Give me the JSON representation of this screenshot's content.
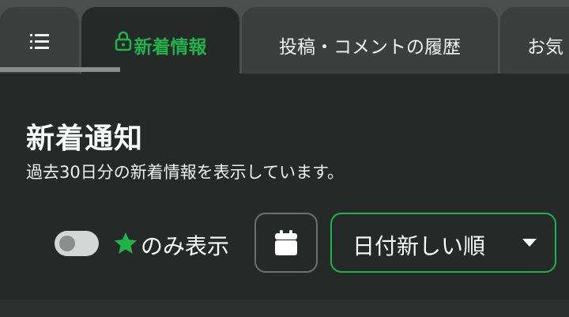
{
  "tabs": {
    "menu": {
      "icon": "menu-list-icon"
    },
    "news": {
      "label": "新着情報",
      "icon": "lock-icon",
      "active": true
    },
    "posts": {
      "label": "投稿・コメントの履歴"
    },
    "favorites": {
      "label": "お気"
    }
  },
  "main": {
    "title": "新着通知",
    "subtitle": "過去30日分の新着情報を表示しています。"
  },
  "filters": {
    "star_only": {
      "enabled": false,
      "icon": "star-icon",
      "label": "のみ表示"
    },
    "calendar": {
      "icon": "calendar-icon"
    },
    "sort": {
      "selected": "日付新しい順",
      "icon": "chevron-down-icon"
    }
  },
  "colors": {
    "accent": "#21b24b",
    "panel": "#252928",
    "tab_inactive": "#3b3f3e",
    "background": "#4a4e4d"
  }
}
